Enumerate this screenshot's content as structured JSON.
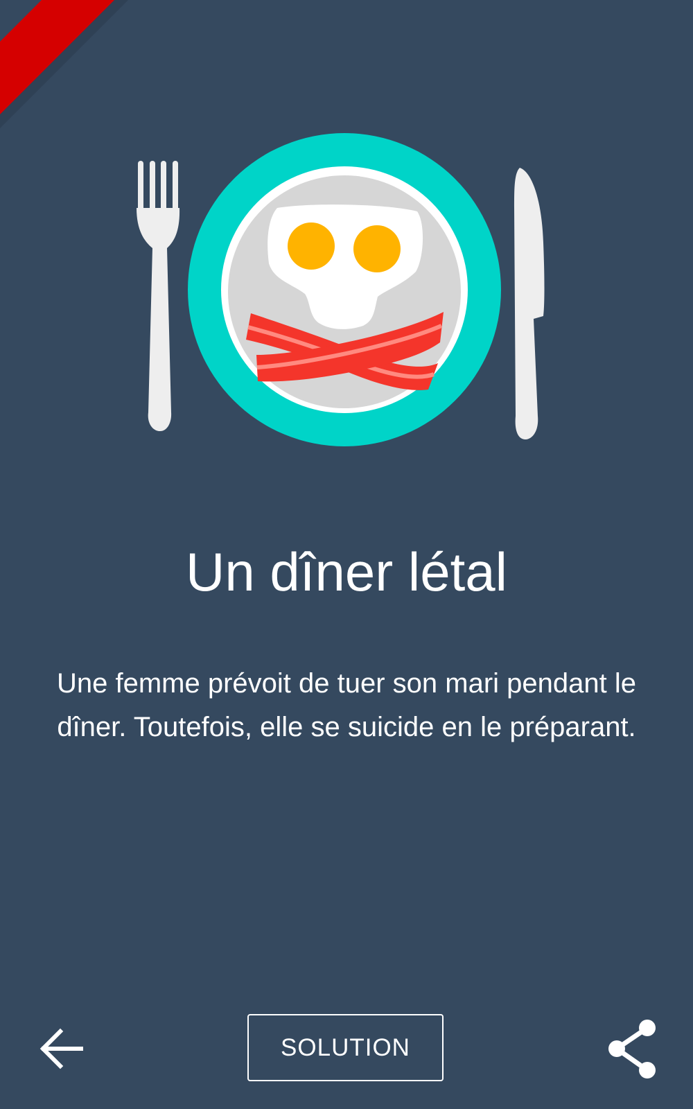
{
  "colors": {
    "background": "#35495f",
    "ribbon": "#d50000",
    "plate_rim": "#00d4c8",
    "plate_inner": "#d6d6d6",
    "egg_white": "#ffffff",
    "yolk": "#ffb300",
    "bacon": "#f4352b",
    "cutlery": "#eeeeee",
    "text": "#ffffff"
  },
  "illustration": {
    "icons": [
      "fork-icon",
      "plate-icon",
      "fried-egg-icon",
      "bacon-icon",
      "knife-icon"
    ]
  },
  "puzzle": {
    "title": "Un dîner létal",
    "description": "Une femme prévoit de tuer son mari pendant le dîner. Toutefois, elle se suicide en le préparant."
  },
  "bottom_bar": {
    "back_icon": "arrow-left-icon",
    "solution_label": "SOLUTION",
    "share_icon": "share-icon"
  }
}
